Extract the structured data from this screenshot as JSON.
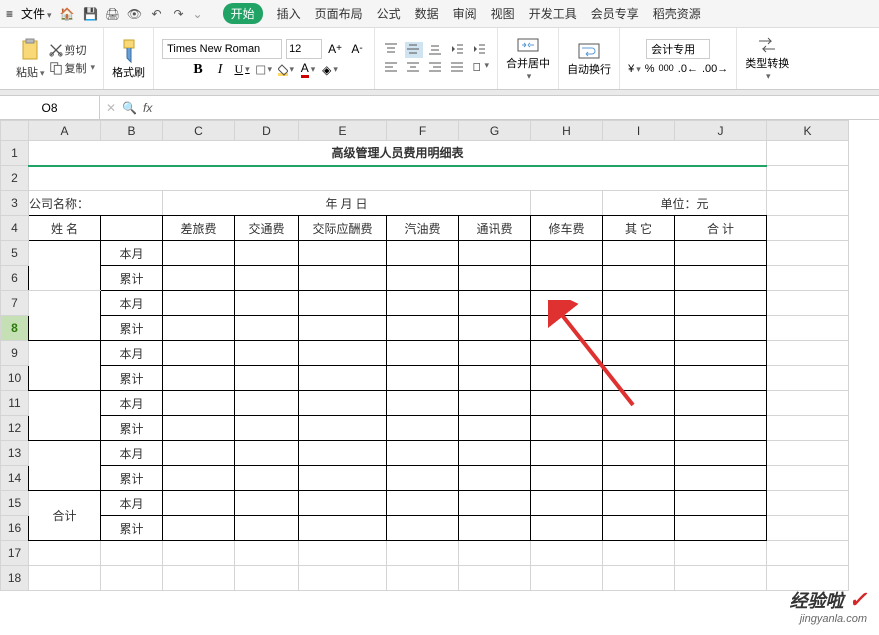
{
  "menu": {
    "file": "文件",
    "dropdown": "⌄"
  },
  "tabs": {
    "start": "开始",
    "insert": "插入",
    "layout": "页面布局",
    "formula": "公式",
    "data": "数据",
    "review": "审阅",
    "view": "视图",
    "dev": "开发工具",
    "member": "会员专享",
    "doke": "稻壳资源"
  },
  "ribbon": {
    "paste": "粘贴",
    "cut": "剪切",
    "copy": "复制",
    "brush": "格式刷",
    "font": "Times New Roman",
    "size": "12",
    "merge": "合并居中",
    "wrap": "自动换行",
    "numfmt": "会计专用",
    "convert": "类型转换"
  },
  "formula": {
    "namebox": "O8",
    "fx": "fx"
  },
  "cols": {
    "A": "A",
    "B": "B",
    "C": "C",
    "D": "D",
    "E": "E",
    "F": "F",
    "G": "G",
    "H": "H",
    "I": "I",
    "J": "J",
    "K": "K"
  },
  "rows": [
    "1",
    "2",
    "3",
    "4",
    "5",
    "6",
    "7",
    "8",
    "9",
    "10",
    "11",
    "12",
    "13",
    "14",
    "15",
    "16",
    "17",
    "18"
  ],
  "cells": {
    "title": "高级管理人员费用明细表",
    "company": "公司名称：",
    "date": "年   月   日",
    "unit": "单位：元",
    "h_name": "姓  名",
    "h_travel": "差旅费",
    "h_trans": "交通费",
    "h_ent": "交际应酬费",
    "h_fuel": "汽油费",
    "h_comm": "通讯费",
    "h_repair": "修车费",
    "h_other": "其  它",
    "h_total": "合  计",
    "month": "本月",
    "cumul": "累计",
    "grand": "合计"
  },
  "watermark": {
    "main": "经验啦",
    "sub": "jingyanla.com"
  }
}
